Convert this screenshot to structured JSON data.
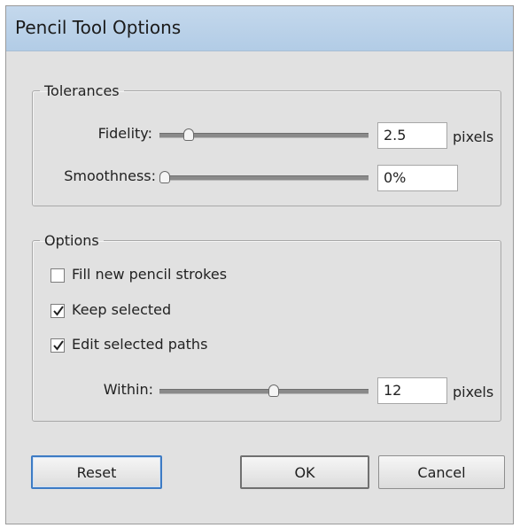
{
  "dialog": {
    "title": "Pencil Tool Options"
  },
  "tolerances": {
    "legend": "Tolerances",
    "fidelity": {
      "label": "Fidelity:",
      "value": "2.5",
      "unit": "pixels",
      "slider_fraction": 0.12
    },
    "smoothness": {
      "label": "Smoothness:",
      "value": "0%",
      "slider_fraction": 0.0
    }
  },
  "options": {
    "legend": "Options",
    "fill_new": {
      "label": "Fill new pencil strokes",
      "checked": false
    },
    "keep_selected": {
      "label": "Keep selected",
      "checked": true
    },
    "edit_paths": {
      "label": "Edit selected paths",
      "checked": true
    },
    "within": {
      "label": "Within:",
      "value": "12",
      "unit": "pixels",
      "slider_fraction": 0.55
    }
  },
  "buttons": {
    "reset": "Reset",
    "ok": "OK",
    "cancel": "Cancel"
  },
  "colors": {
    "titlebar": "#b8d0e8",
    "dialog_bg": "#e1e1e1",
    "focus_border": "#3d7bc4"
  }
}
